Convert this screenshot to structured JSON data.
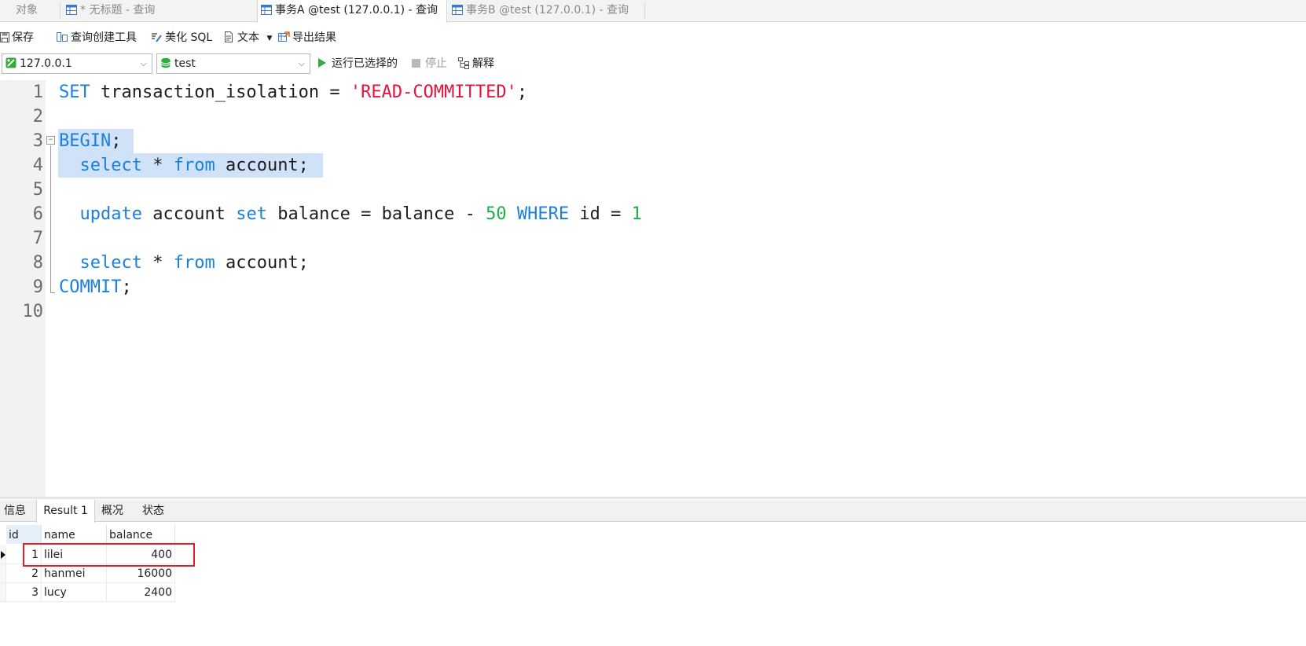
{
  "tabs": [
    {
      "label": "对象"
    },
    {
      "label": "* 无标题 - 查询"
    },
    {
      "label": "事务A @test (127.0.0.1) - 查询"
    },
    {
      "label": "事务B @test (127.0.0.1) - 查询"
    }
  ],
  "toolbar": {
    "save": "保存",
    "query_builder": "查询创建工具",
    "beautify": "美化 SQL",
    "text": "文本",
    "export": "导出结果"
  },
  "connection": {
    "host": "127.0.0.1",
    "database": "test",
    "run_selected": "运行已选择的",
    "stop": "停止",
    "explain": "解释"
  },
  "editor": {
    "line_numbers": [
      "1",
      "2",
      "3",
      "4",
      "5",
      "6",
      "7",
      "8",
      "9",
      "10"
    ],
    "lines": [
      [
        {
          "t": "SET",
          "c": "kw"
        },
        {
          "t": " transaction_isolation = ",
          "c": ""
        },
        {
          "t": "'READ-COMMITTED'",
          "c": "str"
        },
        {
          "t": ";",
          "c": ""
        }
      ],
      [],
      [
        {
          "t": "BEGIN",
          "c": "kw"
        },
        {
          "t": ";",
          "c": ""
        }
      ],
      [
        {
          "t": "  ",
          "c": ""
        },
        {
          "t": "select",
          "c": "kw"
        },
        {
          "t": " * ",
          "c": ""
        },
        {
          "t": "from",
          "c": "kw"
        },
        {
          "t": " account;",
          "c": ""
        }
      ],
      [],
      [
        {
          "t": "  ",
          "c": ""
        },
        {
          "t": "update",
          "c": "kw"
        },
        {
          "t": " account ",
          "c": ""
        },
        {
          "t": "set",
          "c": "kw"
        },
        {
          "t": " balance = balance - ",
          "c": ""
        },
        {
          "t": "50",
          "c": "num"
        },
        {
          "t": " ",
          "c": ""
        },
        {
          "t": "WHERE",
          "c": "kw"
        },
        {
          "t": " id = ",
          "c": ""
        },
        {
          "t": "1",
          "c": "num"
        }
      ],
      [],
      [
        {
          "t": "  ",
          "c": ""
        },
        {
          "t": "select",
          "c": "kw"
        },
        {
          "t": " * ",
          "c": ""
        },
        {
          "t": "from",
          "c": "kw"
        },
        {
          "t": " account;",
          "c": ""
        }
      ],
      [
        {
          "t": "COMMIT",
          "c": "kw"
        },
        {
          "t": ";",
          "c": ""
        }
      ],
      []
    ]
  },
  "result_tabs": [
    {
      "label": "信息"
    },
    {
      "label": "Result 1"
    },
    {
      "label": "概况"
    },
    {
      "label": "状态"
    }
  ],
  "result": {
    "columns": [
      "id",
      "name",
      "balance"
    ],
    "rows": [
      {
        "id": "1",
        "name": "lilei",
        "balance": "400"
      },
      {
        "id": "2",
        "name": "hanmei",
        "balance": "16000"
      },
      {
        "id": "3",
        "name": "lucy",
        "balance": "2400"
      }
    ]
  },
  "colors": {
    "keyword": "#1a7fde",
    "string": "#e0143c",
    "number": "#1fae4b",
    "selection": "#cfe2f7",
    "highlight_box": "#e02020"
  }
}
